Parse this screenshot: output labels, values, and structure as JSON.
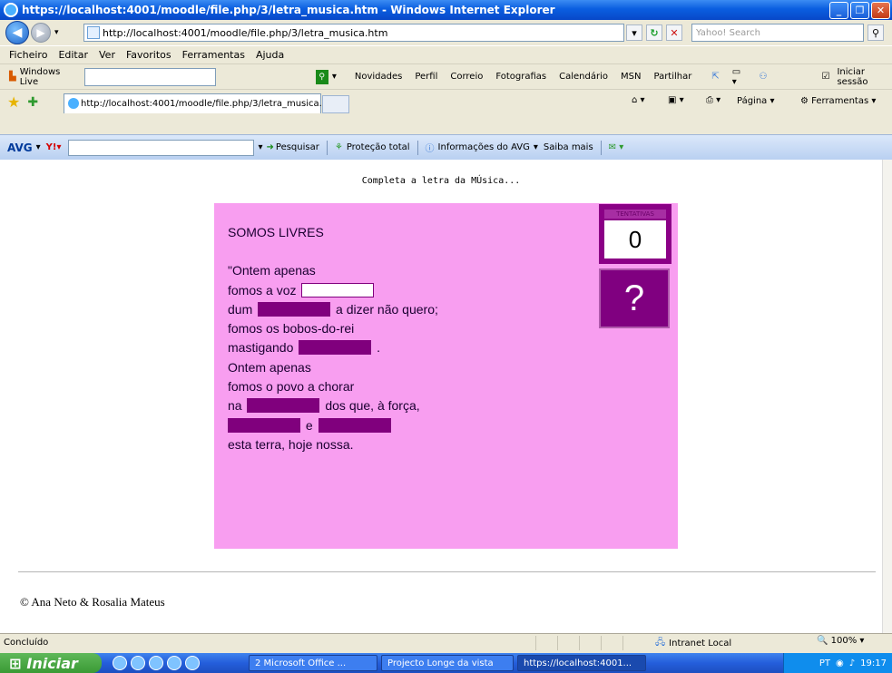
{
  "window": {
    "title": "https://localhost:4001/moodle/file.php/3/letra_musica.htm - Windows Internet Explorer"
  },
  "address": {
    "url": "http://localhost:4001/moodle/file.php/3/letra_musica.htm",
    "search_placeholder": "Yahoo! Search"
  },
  "menu": [
    "Ficheiro",
    "Editar",
    "Ver",
    "Favoritos",
    "Ferramentas",
    "Ajuda"
  ],
  "links_bar": {
    "windows_live": "Windows Live",
    "items": [
      "Novidades",
      "Perfil",
      "Correio",
      "Fotografias",
      "Calendário",
      "MSN",
      "Partilhar"
    ],
    "signin": "Iniciar sessão"
  },
  "favs_bar": {
    "tab_title": "http://localhost:4001/moodle/file.php/3/letra_musica....",
    "pagina": "Página",
    "ferramentas": "Ferramentas"
  },
  "avg_bar": {
    "logo": "AVG",
    "pesquisar": "Pesquisar",
    "protecao": "Proteção total",
    "informacoes": "Informações do AVG",
    "saiba": "Saiba mais"
  },
  "page": {
    "instruction": "Completa a letra da MÚsica...",
    "song_title": "SOMOS LIVRES",
    "lines": {
      "l1": "\"Ontem apenas",
      "l2": "fomos a voz",
      "l3a": "dum",
      "l3b": "a dizer não quero;",
      "l4": "fomos os bobos-do-rei",
      "l5a": "mastigando",
      "l5b": ".",
      "l6": "Ontem apenas",
      "l7": "fomos o povo a chorar",
      "l8a": "na",
      "l8b": "dos que, à força,",
      "l9": "e",
      "l10": "esta terra, hoje nossa."
    },
    "tries_label": "TENTATIVAS",
    "tries_value": "0",
    "hint_label": "?",
    "credit": "© Ana Neto & Rosalia Mateus"
  },
  "status": {
    "text": "Concluído",
    "zone": "Intranet Local",
    "zoom": "100%"
  },
  "taskbar": {
    "start": "Iniciar",
    "tasks": [
      "2 Microsoft Office ...",
      "Projecto Longe da vista",
      "https://localhost:4001..."
    ],
    "lang": "PT",
    "clock": "19:17"
  },
  "colors": {
    "panel_bg": "#f89ef0",
    "blank_fill": "#80007d"
  }
}
